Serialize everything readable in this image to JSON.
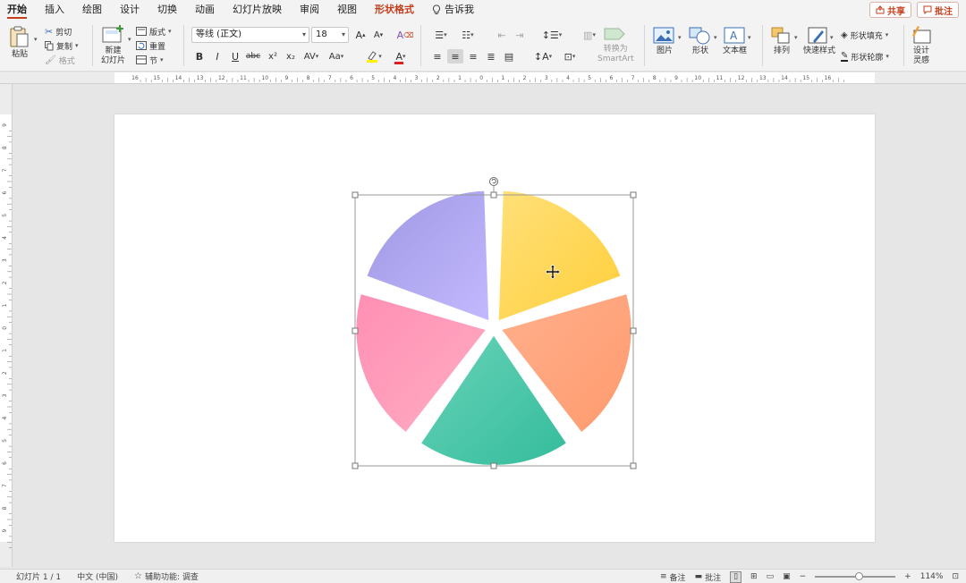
{
  "menu": {
    "tabs": [
      {
        "label": "开始",
        "state": "active"
      },
      {
        "label": "插入"
      },
      {
        "label": "绘图"
      },
      {
        "label": "设计"
      },
      {
        "label": "切换"
      },
      {
        "label": "动画"
      },
      {
        "label": "幻灯片放映"
      },
      {
        "label": "审阅"
      },
      {
        "label": "视图"
      },
      {
        "label": "形状格式",
        "state": "accent"
      }
    ],
    "tell_me": "告诉我",
    "share": "共享",
    "comments": "批注"
  },
  "ribbon": {
    "paste": "粘贴",
    "cut": "剪切",
    "copy": "复制",
    "format_painter": "格式",
    "new_slide_1": "新建",
    "new_slide_2": "幻灯片",
    "layout": "版式",
    "reset": "重置",
    "section": "节",
    "font_name": "等线 (正文)",
    "font_size": "18",
    "bold": "B",
    "italic": "I",
    "underline": "U",
    "strike": "abc",
    "superscript": "x²",
    "subscript": "x₂",
    "char_spacing": "AV",
    "change_case": "Aa",
    "convert_smartart_1": "转换为",
    "convert_smartart_2": "SmartArt",
    "picture": "图片",
    "shapes": "形状",
    "textbox": "文本框",
    "arrange": "排列",
    "quick_styles": "快速样式",
    "shape_fill": "形状填充",
    "shape_outline": "形状轮廓",
    "designer_1": "设计",
    "designer_2": "灵感"
  },
  "ruler": {
    "h_ticks": [
      "16",
      "15",
      "14",
      "13",
      "12",
      "11",
      "10",
      "9",
      "8",
      "7",
      "6",
      "5",
      "4",
      "3",
      "2",
      "1",
      "0",
      "1",
      "2",
      "3",
      "4",
      "5",
      "6",
      "7",
      "8",
      "9",
      "10",
      "11",
      "12",
      "13",
      "14",
      "15",
      "16"
    ],
    "v_ticks": [
      "9",
      "8",
      "7",
      "6",
      "5",
      "4",
      "3",
      "2",
      "1",
      "0",
      "1",
      "2",
      "3",
      "4",
      "5",
      "6",
      "7",
      "8",
      "9"
    ]
  },
  "pie": {
    "slices": [
      {
        "name": "yellow",
        "from": "#FFE07A",
        "to": "#FFCF3A",
        "start": 2,
        "end": 70
      },
      {
        "name": "orange",
        "from": "#FFB08C",
        "to": "#FF9A6E",
        "start": 74,
        "end": 142
      },
      {
        "name": "green",
        "from": "#69D3B8",
        "to": "#34BC9C",
        "start": 146,
        "end": 214
      },
      {
        "name": "pink",
        "from": "#FF8FB4",
        "to": "#FFADC3",
        "start": 218,
        "end": 286
      },
      {
        "name": "purple",
        "from": "#9E98E2",
        "to": "#C3B9FF",
        "start": 290,
        "end": 358
      }
    ]
  },
  "status": {
    "slide": "幻灯片 1 / 1",
    "language": "中文 (中国)",
    "accessibility": "辅助功能: 调查",
    "notes": "备注",
    "comments": "批注",
    "zoom": "114%",
    "zoom_level": 0.55
  }
}
